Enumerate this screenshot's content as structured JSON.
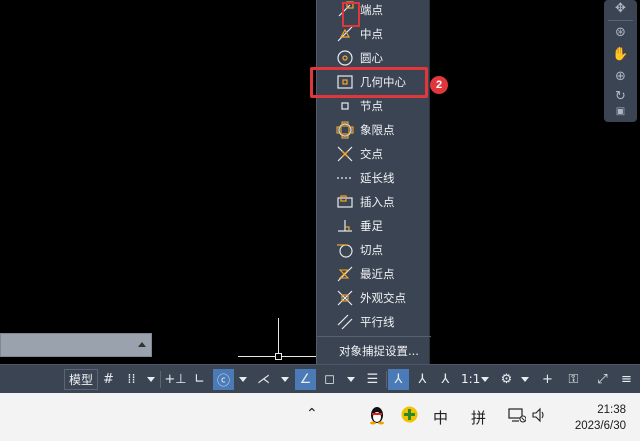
{
  "snap_menu": {
    "items": [
      {
        "label": "端点",
        "icon": "endpoint-snap-icon"
      },
      {
        "label": "中点",
        "icon": "midpoint-snap-icon"
      },
      {
        "label": "圆心",
        "icon": "center-snap-icon"
      },
      {
        "label": "几何中心",
        "icon": "geometric-center-snap-icon"
      },
      {
        "label": "节点",
        "icon": "node-snap-icon"
      },
      {
        "label": "象限点",
        "icon": "quadrant-snap-icon"
      },
      {
        "label": "交点",
        "icon": "intersection-snap-icon"
      },
      {
        "label": "延长线",
        "icon": "extension-snap-icon"
      },
      {
        "label": "插入点",
        "icon": "insertion-snap-icon"
      },
      {
        "label": "垂足",
        "icon": "perpendicular-snap-icon"
      },
      {
        "label": "切点",
        "icon": "tangent-snap-icon"
      },
      {
        "label": "最近点",
        "icon": "nearest-snap-icon"
      },
      {
        "label": "外观交点",
        "icon": "apparent-intersection-snap-icon"
      },
      {
        "label": "平行线",
        "icon": "parallel-snap-icon"
      }
    ],
    "settings_label": "对象捕捉设置..."
  },
  "annotations": {
    "step1": "1",
    "step2": "2",
    "highlight_color": "#e0373d"
  },
  "statusbar": {
    "model_label": "模型",
    "scale_label": "1:1",
    "active_color": "#4a7bb7"
  },
  "taskbar": {
    "ime_label": "中",
    "pinyin_label": "拼",
    "time": "21:38",
    "date": "2023/6/30"
  }
}
